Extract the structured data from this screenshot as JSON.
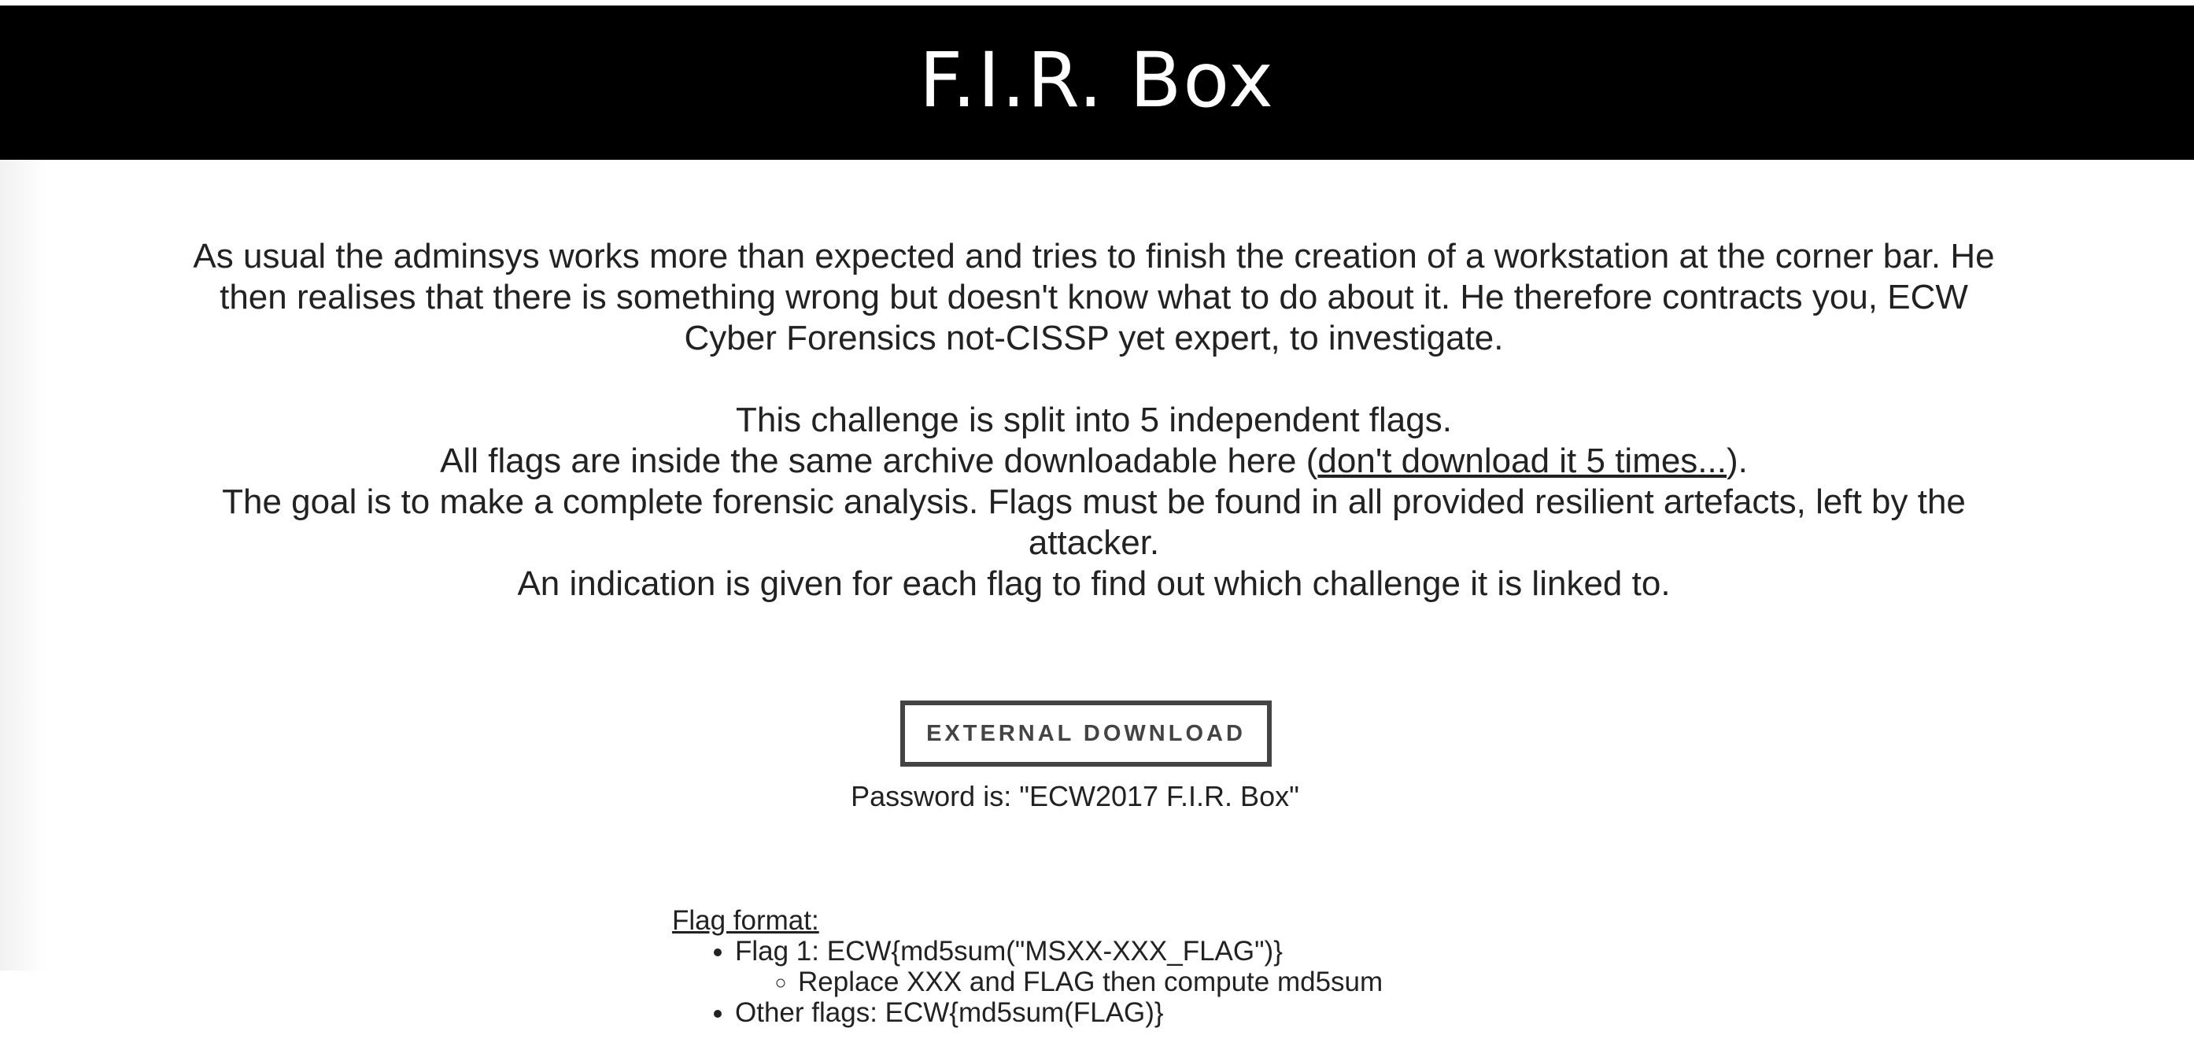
{
  "header": {
    "title": "F.I.R. Box"
  },
  "intro": {
    "text": "As usual the adminsys works more than expected and tries to finish the creation of a workstation at the corner bar. He then realises that there is something wrong but doesn't know what to do about it. He therefore contracts you, ECW Cyber Forensics not-CISSP yet expert, to investigate."
  },
  "details": {
    "line1": "This challenge is split into 5 independent flags.",
    "line2_prefix": "All flags are inside the same archive downloadable here (",
    "line2_link": "don't download it 5 times...",
    "line2_suffix": ").",
    "line3": "The goal is to make a complete forensic analysis. Flags must be found in all provided resilient artefacts, left by the attacker.",
    "line4": "An indication is given for each flag to find out which challenge it is linked to."
  },
  "download": {
    "button_label": "EXTERNAL DOWNLOAD",
    "password_text": "Password is: \"ECW2017 F.I.R. Box\""
  },
  "flag_format": {
    "heading": "Flag format:",
    "items": [
      {
        "text": "Flag 1: ECW{md5sum(\"MSXX-XXX_FLAG\")}",
        "sub": "Replace XXX and FLAG then compute md5sum"
      },
      {
        "text": "Other flags: ECW{md5sum(FLAG)}"
      }
    ]
  }
}
